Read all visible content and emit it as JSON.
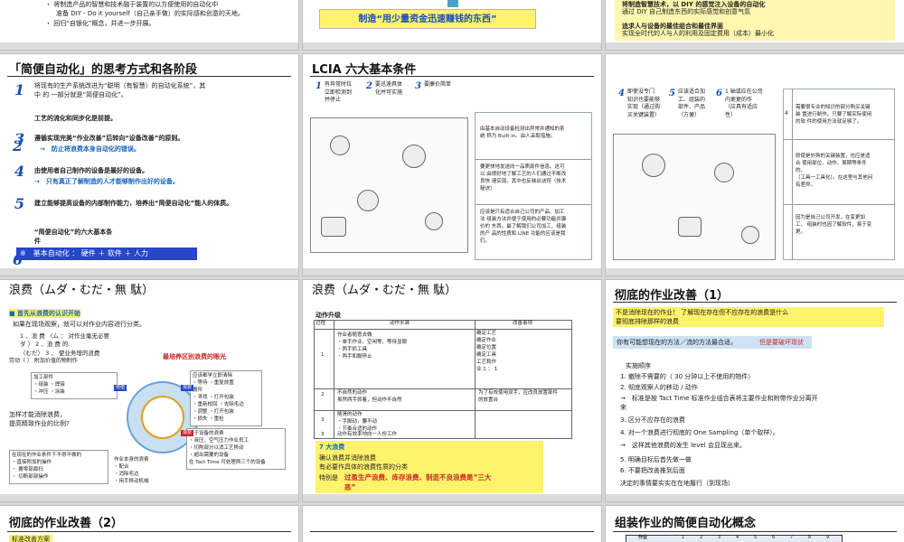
{
  "top": {
    "a_lines": [
      "・ 将制造产品的智慧和技术融于装置的以方便使用的自动化中",
      "准备 DIY - Do it yourself（自己亲手做）的实际感和创意的天地。",
      "・ 回归“自银化”概念，并进一步开展。"
    ],
    "b_banner": "制造“用少量资金迅速赚钱的东西”",
    "c_lines": [
      "将制造智慧技术，以 DIY 的感觉注入设备的自动化",
      "通过 DIY 自己制造东西的实际感觉和创意气氛",
      "追求人与设备的最佳组合和最佳界面",
      "实现全时代的人与人的利用及固定费用（成本）最小化"
    ]
  },
  "s1": {
    "title": "「简便自动化」的思考方式和各阶段",
    "n": [
      "1",
      "3",
      "2",
      "4",
      "5",
      "6"
    ],
    "p1": "将现有的生产系统改进为“聪明（有智慧）的自动化系统”，其\n中 的 一部分就是“简便自动化”。",
    "p1b": "工艺的流化和同步化是前提。",
    "p3": "遵循实现完美“作业改善”后转向“设备改善”的原则。",
    "p3a": "→　防止将浪费本身自动化的错误。",
    "p4": "由使用者自己制作的设备是最好的设备。",
    "p4a": "→　只有真正了解制造的人才能够制作出好的设备。",
    "p5": "建立能够提高设备的内部制作能力，培养出“简便自动化”能人的体质。",
    "p6": "“简便自动化”的六大基本条\n件",
    "banner": "※　基本自动化 ： 硬件 ＋ 软件 ＋ 人力"
  },
  "s2": {
    "title": "LCIA  六大基本条件",
    "h": [
      {
        "n": "1",
        "t": "有异常时拉\n立即检测到\n并停止"
      },
      {
        "n": "2",
        "t": "要迅速具体\n化并可实施"
      },
      {
        "n": "3",
        "t": "要廉价简单"
      }
    ],
    "rows": [
      "由基本自动设备检测出异常并通知的系\n统 称为 Built in。由人采取措施。",
      "要更快地发送向一品质部件信息。这可\n以 由很好地了解工艺的人们通过不断改\n良快 速实现。其中也反映出诀窍（技术\n秘诀）",
      "应该是只有适合自己公司的产品、加工\n法 组装方法并便于使用的必要功能并廉\n价的 东西。最了解我们公司加工、组装\n的产 品的性质和 LINE 功能的应该是我\n们。"
    ]
  },
  "s3": {
    "h": [
      {
        "n": "4",
        "t": "即使没专门\n知识也要能够\n实现（通过购\n买关键装置）"
      },
      {
        "n": "5",
        "t": "应该适合加\n工、组装的\n部件、产品\n（方便）"
      },
      {
        "n": "6",
        "t": "1 轴或应在公司\n内更更的作\n（应具有适应\n性）"
      }
    ],
    "cell_no": "4",
    "rows": [
      "需要很专业的知识的部分购买关键\n装 置进行制作。只要了解实际使用\n的软 件的使用方法就足够了。",
      "即使是外购的关键装置，也应是适\n合 使用部位、动作、周期等条件\n的。\n（工具一工具化）。在这里与其他问\n有差异。",
      "因为是自己公司开发，在变更加\n工、 组装时也因了解软件，易于变\n更。"
    ]
  },
  "s4": {
    "title": "浪费（ムダ・むだ・無\n駄）",
    "l1": "■ 首先从浪费的认识开始",
    "l2": "如果在现场观察，就可以对作业内容进行分类。",
    "l3": "1 、浪 费 （ム ： 对作业毫无必要\n  ダ ）  2 、浪 费 的\n（むだ） 3 、  使业务增的浪费",
    "l3b": "劳动（ ）  附加价值的物制作",
    "pink": "最培养区别浪费的眼光",
    "boxes": [
      "加工部件\n・组装    ・焊接\n・冲压    ・涂装",
      "应该都学立即清除\n・等待        ・重复放置\n搬件\n・寻找        ・打开包装\n・重新校回    ・去除毛边\n・调整        ・打开包装\n・损失        ・重检",
      "最于设备的浪费\n・液压、空气压力作业员工\n・切削部分以消工艺移动\n・超出需要的设备\n在 Tact Time 可处理两三个的设备"
    ],
    "q": "怎样才能消除浪费，\n提高精致作业的比例?",
    "bottom": [
      "在现在的作业条件下不得不做的\n・直接附加的操作\n  ・ 搬零部面扫\n  ・ 切断部部操作",
      "作业本身的浪费\n・配合\n・消除毛边\n・用手移动机械"
    ],
    "tags": [
      "增值",
      "浪费",
      "浪费"
    ]
  },
  "s5": {
    "title": "浪费（ムダ・むだ・無\n駄）",
    "sub": "动作升级",
    "cols": [
      "过程",
      "动作水准",
      "改善事项"
    ],
    "r1": [
      "1",
      "作业者随意去做\n・单手作业、空闲等、等待显眼\n・两手抓工具\n・两手和脚停止",
      "确定工艺\n确定作业\n确定位置\n确定工具\n工艺和作\n业 1 ： 1"
    ],
    "r2": [
      "2",
      "不自然的动作\n虽然两手抓着，但动作不自然",
      "为了有效使用双手，应改良放置部件\n的放置台"
    ],
    "r3": [
      "3",
      "随滑的动作\n・手脚动，腰不动\n・节奏合适的动作"
    ],
    "r4": [
      "3",
      "动作有效率地向一人份工作"
    ],
    "g1": "7 大浪费",
    "g2": "确认浪费并消除浪费\n有必要作具体的浪费性质的分类",
    "g3": "特别是",
    "g4": "过盈生产浪费、库存浪费、制造不良浪费是“三大\n恶”"
  },
  "s6": {
    "title": "彻底的作业改善（1）",
    "y1": "不是消除现在的作业！ 了解现在存在但不应存在的浪费是什么\n要彻底排除那样的浪费",
    "y2a": "你有可能想现在的方法／流的方法最合适，",
    "y2b": "但是要破坏现状",
    "steps": [
      "实施顺序",
      "1.  撤除不需要的（ 30 分钟以上不使用的物件）",
      "2.  彻底观察人的移动 / 动作",
      "    →　标准是按 Tact Time  标准作业组合表将主要作业和附带作业分离开\n   来",
      "3.  区分不应存在的浪费",
      "4.  对一个浪费进行彻底的 One Sampling（单个取样）。",
      "    →　这样其他浪费的发生 level 会显现出来。",
      "5.   明确目标后首先做一做",
      "6.   不要把改善推到后面",
      "     决定的事情要实实在在地履行（到现场）"
    ]
  },
  "s7": {
    "title": "彻底的作业改善（2）",
    "tag": "标准改善方案"
  },
  "s9": {
    "title": "组装作业的简便自动化概念",
    "row_head": "作业",
    "cols": [
      "1",
      "2",
      "3",
      "4",
      "5",
      "6",
      "7",
      "8",
      "9"
    ]
  }
}
